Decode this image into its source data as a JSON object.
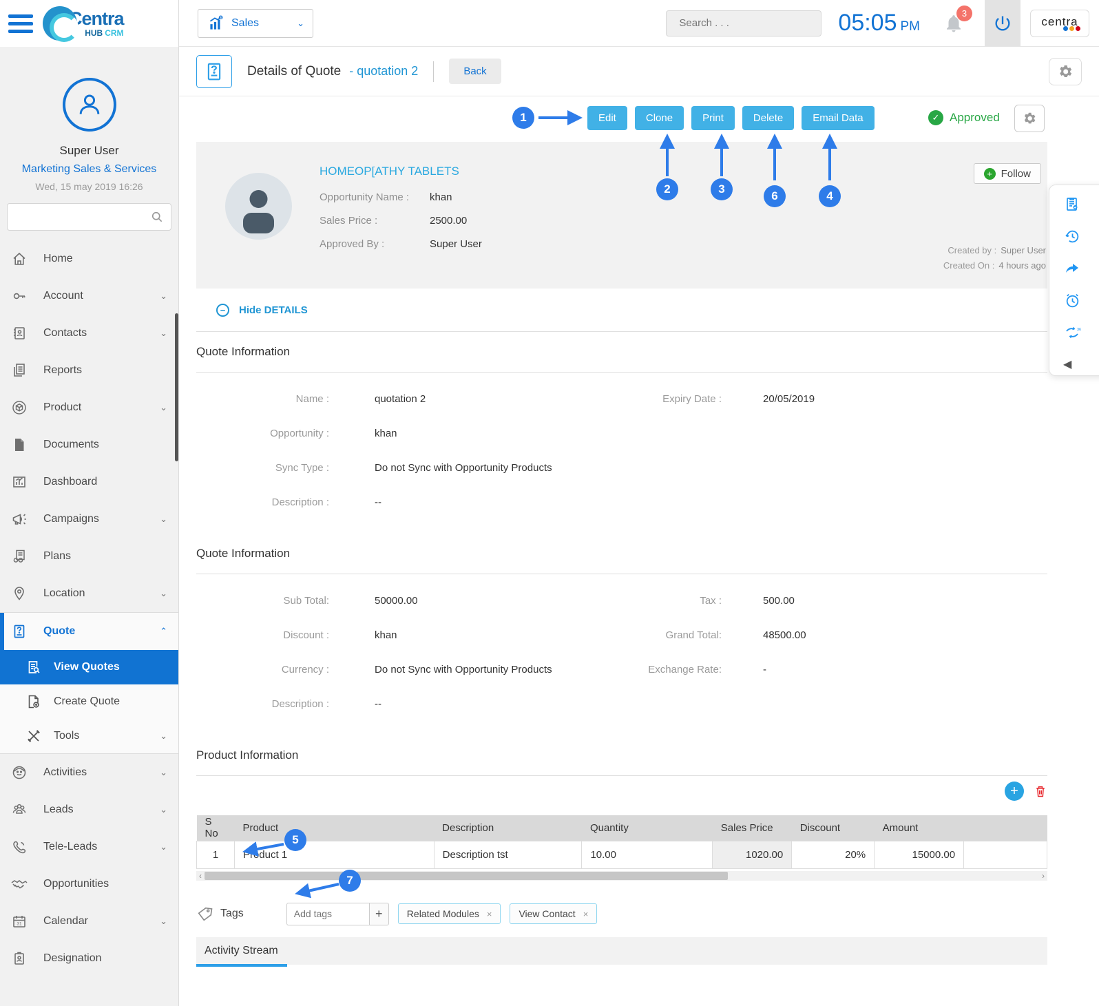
{
  "colors": {
    "accent_blue": "#1273d4",
    "button_blue": "#41b1e6",
    "annotation_blue": "#2e7ce9",
    "approved_green": "#28a745",
    "delete_red": "#e8262b",
    "badge_red": "#f4736a"
  },
  "icons": {
    "left_arrow": "‹",
    "right_arrow": "›",
    "collapse_left": "◀",
    "close": "×",
    "plus": "+",
    "minus": "−",
    "check": "✓",
    "calendar_day": "31"
  },
  "logo": {
    "brand": "Centra",
    "hub": "HUB",
    "crm": "CRM"
  },
  "header": {
    "module_selector": "Sales",
    "search_placeholder": "Search . . .",
    "time": "05:05",
    "time_period": "PM",
    "notification_count": "3",
    "brand_badge": "centra"
  },
  "page_header": {
    "title": "Details of Quote",
    "subtitle": "- quotation 2",
    "back_label": "Back"
  },
  "toolbar": {
    "edit": "Edit",
    "clone": "Clone",
    "print": "Print",
    "delete": "Delete",
    "email_data": "Email Data",
    "status": "Approved"
  },
  "sidebar": {
    "user": {
      "name": "Super User",
      "department": "Marketing Sales & Services",
      "datetime": "Wed, 15 may 2019 16:26"
    },
    "items": [
      {
        "label": "Home"
      },
      {
        "label": "Account"
      },
      {
        "label": "Contacts"
      },
      {
        "label": "Reports"
      },
      {
        "label": "Product"
      },
      {
        "label": "Documents"
      },
      {
        "label": "Dashboard"
      },
      {
        "label": "Campaigns"
      },
      {
        "label": "Plans"
      },
      {
        "label": "Location"
      },
      {
        "label": "Quote"
      },
      {
        "label": "Activities"
      },
      {
        "label": "Leads"
      },
      {
        "label": "Tele-Leads"
      },
      {
        "label": "Opportunities"
      },
      {
        "label": "Calendar"
      },
      {
        "label": "Designation"
      }
    ],
    "quote_submenu": [
      {
        "label": "View Quotes"
      },
      {
        "label": "Create Quote"
      },
      {
        "label": "Tools"
      }
    ]
  },
  "quote_card": {
    "title": "HOMEOP[ATHY TABLETS",
    "fields": [
      {
        "label": "Opportunity Name :",
        "value": "khan"
      },
      {
        "label": "Sales Price :",
        "value": "2500.00"
      },
      {
        "label": "Approved By :",
        "value": "Super User"
      }
    ],
    "follow_label": "Follow",
    "created_by_label": "Created by :",
    "created_by": "Super User",
    "created_on_label": "Created On :",
    "created_on": "4 hours ago"
  },
  "details_toggle": "Hide DETAILS",
  "quote_info_1": {
    "heading": "Quote Information",
    "left": [
      {
        "label": "Name :",
        "value": "quotation 2"
      },
      {
        "label": "Opportunity :",
        "value": "khan"
      },
      {
        "label": "Sync Type :",
        "value": "Do not Sync with Opportunity Products"
      },
      {
        "label": "Description :",
        "value": "--"
      }
    ],
    "right": [
      {
        "label": "Expiry Date :",
        "value": "20/05/2019"
      }
    ]
  },
  "quote_info_2": {
    "heading": "Quote Information",
    "left": [
      {
        "label": "Sub Total:",
        "value": "50000.00"
      },
      {
        "label": "Discount  :",
        "value": "khan"
      },
      {
        "label": "Currency :",
        "value": "Do not Sync with Opportunity Products"
      },
      {
        "label": "Description :",
        "value": "--"
      }
    ],
    "right": [
      {
        "label": "Tax :",
        "value": "500.00"
      },
      {
        "label": "Grand Total:",
        "value": "48500.00"
      },
      {
        "label": "Exchange Rate:",
        "value": "-"
      }
    ]
  },
  "product_info": {
    "heading": "Product Information",
    "columns": [
      "S No",
      "Product",
      "Description",
      "Quantity",
      "Sales Price",
      "Discount",
      "Amount"
    ],
    "rows": [
      [
        "1",
        "Product 1",
        "Description tst",
        "10.00",
        "1020.00",
        "20%",
        "15000.00"
      ]
    ]
  },
  "tags": {
    "label": "Tags",
    "placeholder": "Add tags",
    "chips": [
      {
        "label": "Related Modules"
      },
      {
        "label": "View Contact"
      }
    ]
  },
  "activity": {
    "heading": "Activity Stream"
  },
  "annotations": [
    "1",
    "2",
    "3",
    "6",
    "4",
    "5",
    "7"
  ]
}
